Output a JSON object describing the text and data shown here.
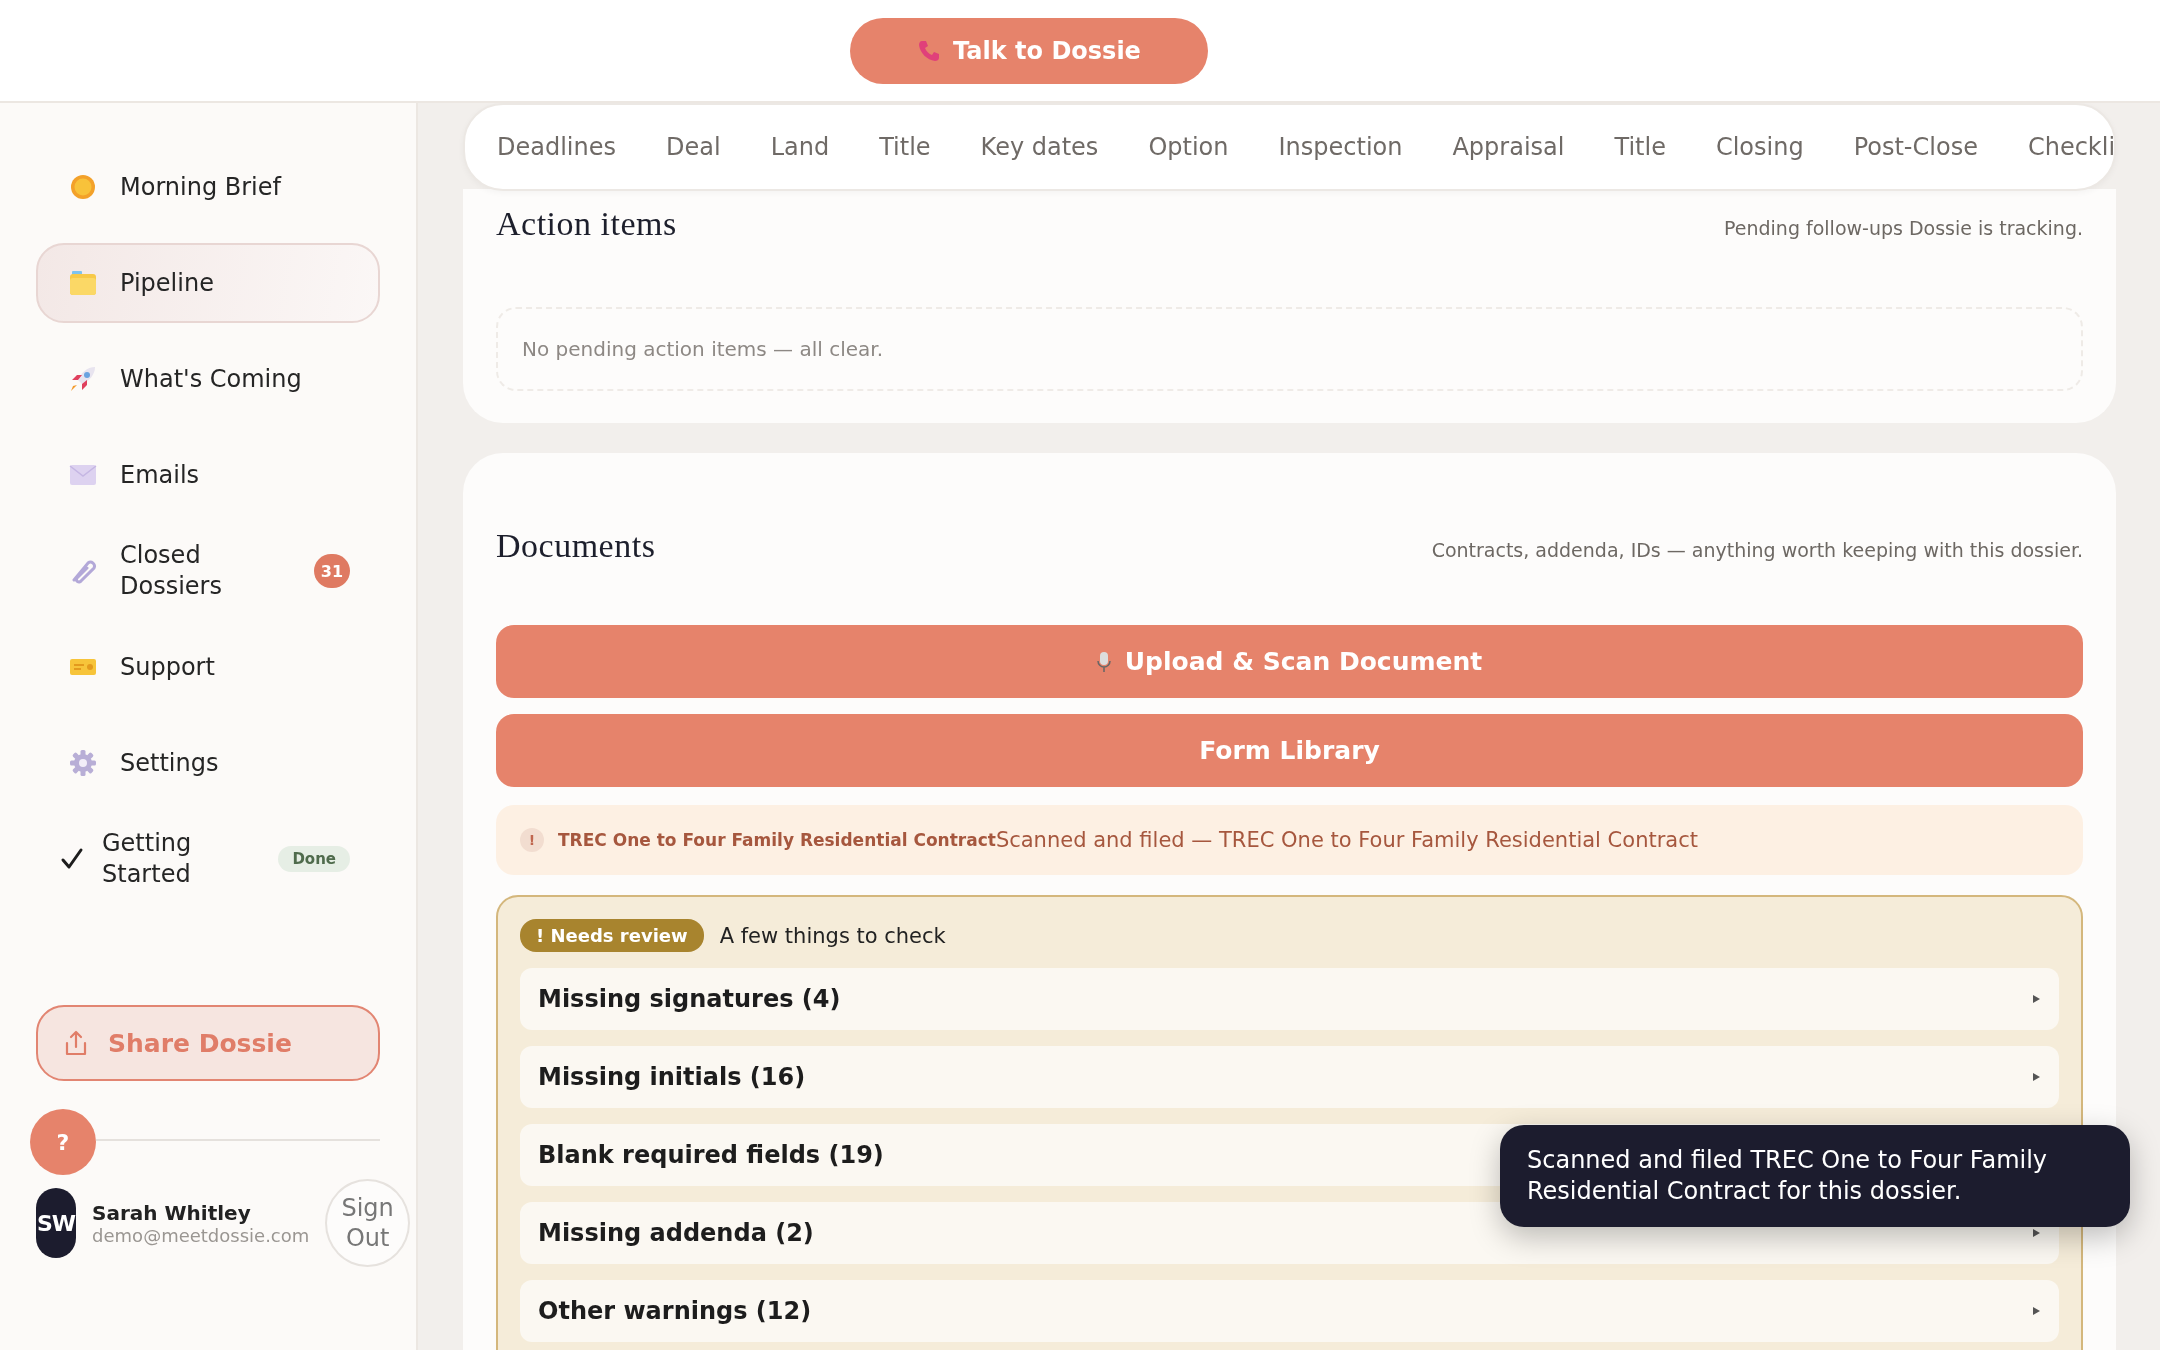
{
  "top_bar": {
    "call_button": "Talk to Dossie"
  },
  "sidebar": {
    "items": [
      {
        "label": "Morning Brief",
        "kind": "nav",
        "selected": false
      },
      {
        "label": "Pipeline",
        "kind": "nav",
        "selected": true
      },
      {
        "label": "What's Coming",
        "kind": "nav",
        "selected": false
      },
      {
        "label": "Emails",
        "kind": "nav",
        "selected": false
      },
      {
        "label": "Closed Dossiers",
        "kind": "nav",
        "selected": false,
        "badge": "31"
      },
      {
        "label": "Support",
        "kind": "nav",
        "selected": false
      },
      {
        "label": "Settings",
        "kind": "nav",
        "selected": false
      },
      {
        "label": "Getting Started",
        "kind": "task",
        "selected": false,
        "tag": "Done"
      }
    ],
    "share_button": "Share Dossie",
    "help_button": "?",
    "user": {
      "initials": "SW",
      "name": "Sarah Whitley",
      "email": "demo@meetdossie.com",
      "sign_out": "Sign Out"
    }
  },
  "tabs": [
    "Deadlines",
    "Deal",
    "Land",
    "Title",
    "Key dates",
    "Option",
    "Inspection",
    "Appraisal",
    "Title",
    "Closing",
    "Post-Close",
    "Checkli"
  ],
  "action_items": {
    "title": "Action items",
    "subtitle": "Pending follow-ups Dossie is tracking.",
    "empty": "No pending action items — all clear."
  },
  "documents": {
    "title": "Documents",
    "subtitle": "Contracts, addenda, IDs — anything worth keeping with this dossier.",
    "upload_button": "Upload & Scan Document",
    "library_button": "Form Library",
    "notice": {
      "icon": "!",
      "document": "TREC One to Four Family Residential Contract",
      "message": "Scanned and filed — TREC One to Four Family Residential Contract"
    },
    "review": {
      "badge": "! Needs review",
      "title": "A few things to check",
      "rows": [
        {
          "label": "Missing signatures (4)"
        },
        {
          "label": "Missing initials (16)"
        },
        {
          "label": "Blank required fields (19)"
        },
        {
          "label": "Missing addenda (2)"
        },
        {
          "label": "Other warnings (12)"
        }
      ]
    }
  },
  "toast": "Scanned and filed TREC One to Four Family Residential Contract for this dossier."
}
